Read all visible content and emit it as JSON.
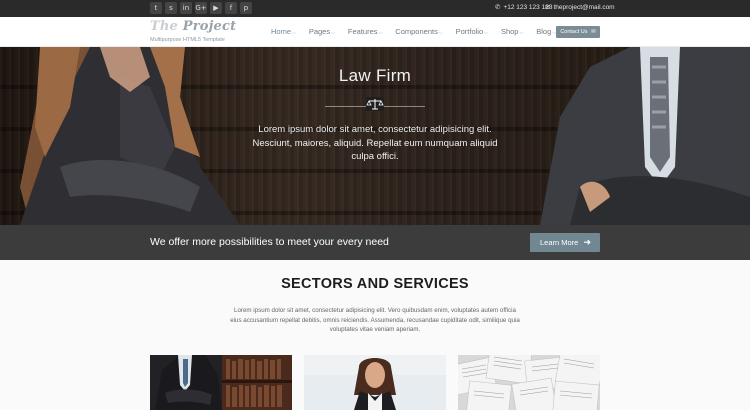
{
  "topbar": {
    "social": [
      "t",
      "s",
      "in",
      "G+",
      "▶",
      "f",
      "p"
    ],
    "social_icons": [
      "twitter-icon",
      "skype-icon",
      "linkedin-icon",
      "googleplus-icon",
      "youtube-icon",
      "facebook-icon",
      "pinterest-icon"
    ],
    "phone": "+12 123 123 123",
    "email": "theproject@mail.com"
  },
  "header": {
    "logo_the": "The",
    "logo_project": "Project",
    "tagline": "Multipurpose HTML5 Template",
    "nav": [
      {
        "label": "Home",
        "active": true
      },
      {
        "label": "Pages"
      },
      {
        "label": "Features"
      },
      {
        "label": "Components"
      },
      {
        "label": "Portfolio"
      },
      {
        "label": "Shop"
      },
      {
        "label": "Blog"
      }
    ],
    "contact_button": "Contact Us"
  },
  "hero": {
    "title": "Law Firm",
    "text": "Lorem ipsum dolor sit amet, consectetur adipisicing elit. Nesciunt, maiores, aliquid. Repellat eum numquam aliquid culpa offici."
  },
  "cta": {
    "text": "We offer more possibilities to meet your every need",
    "button": "Learn More"
  },
  "sectors": {
    "title": "SECTORS AND SERVICES",
    "description": "Lorem ipsum dolor sit amet, consectetur adipisicing elit. Vero quibusdam enim, voluptates autem officia eius accusantium repellat debitis, omnis reiciendis. Assumenda, recusandae cupiditate odit, similique quia voluptates vitae veniam aperiam."
  },
  "colors": {
    "topbar": "#2a2a2a",
    "accent": "#718791",
    "cta_band": "#3c3c3c"
  }
}
